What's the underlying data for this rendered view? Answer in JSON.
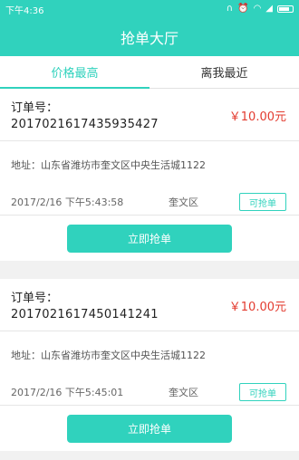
{
  "status": {
    "time": "下午4:36"
  },
  "app": {
    "title": "抢单大厅"
  },
  "tabs": [
    {
      "label": "价格最高",
      "active": true
    },
    {
      "label": "离我最近",
      "active": false
    }
  ],
  "orders": [
    {
      "order_label": "订单号：",
      "order_no": "20170216174359354 27",
      "price": "￥10.00元",
      "address": "地址：山东省潍坊市奎文区中央生活城1122",
      "datetime": "2017/2/16 下午5:43:58",
      "district": "奎文区",
      "badge": "可抢单",
      "button": "立即抢单"
    },
    {
      "order_label": "订单号：",
      "order_no": "2017021617450141241",
      "price": "￥10.00元",
      "address": "地址：山东省潍坊市奎文区中央生活城1122",
      "datetime": "2017/2/16 下午5:45:01",
      "district": "奎文区",
      "badge": "可抢单",
      "button": "立即抢单"
    }
  ],
  "colors": {
    "accent": "#30d2bd",
    "price": "#e33b2f"
  }
}
